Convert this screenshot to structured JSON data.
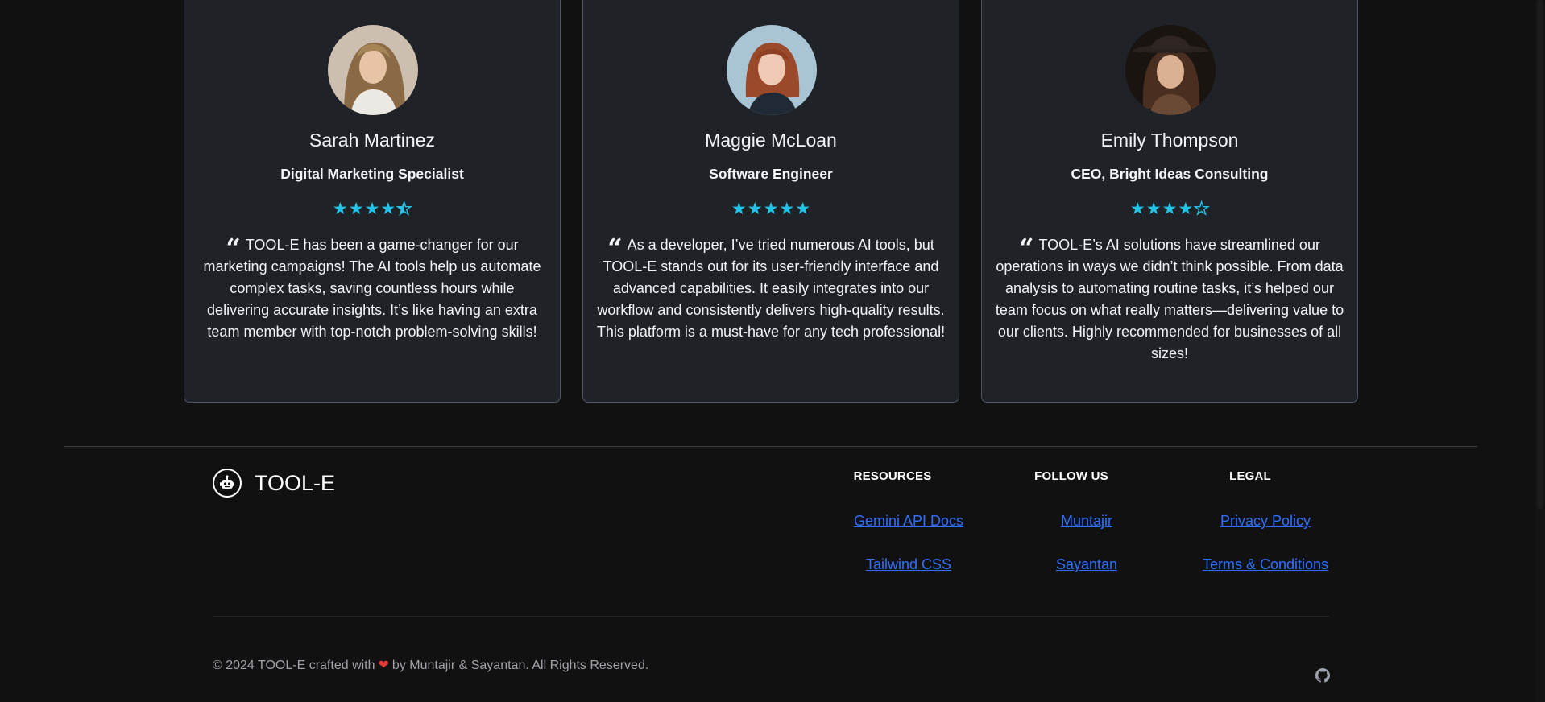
{
  "testimonials": [
    {
      "name": "Sarah Martinez",
      "role": "Digital Marketing Specialist",
      "rating": 4.5,
      "quote": "TOOL-E has been a game-changer for our marketing campaigns! The AI tools help us automate complex tasks, saving countless hours while delivering accurate insights. It’s like having an extra team member with top-notch problem-solving skills!"
    },
    {
      "name": "Maggie McLoan",
      "role": "Software Engineer",
      "rating": 5,
      "quote": "As a developer, I’ve tried numerous AI tools, but TOOL-E stands out for its user-friendly interface and advanced capabilities. It easily integrates into our workflow and consistently delivers high-quality results. This platform is a must-have for any tech professional!"
    },
    {
      "name": "Emily Thompson",
      "role": "CEO, Bright Ideas Consulting",
      "rating": 4,
      "quote": "TOOL-E’s AI solutions have streamlined our operations in ways we didn’t think possible. From data analysis to automating routine tasks, it’s helped our team focus on what really matters—delivering value to our clients. Highly recommended for businesses of all sizes!"
    }
  ],
  "footer": {
    "brand": "TOOL-E",
    "columns": [
      {
        "heading": "RESOURCES",
        "links": [
          "Gemini API Docs",
          "Tailwind CSS"
        ]
      },
      {
        "heading": "FOLLOW US",
        "links": [
          "Muntajir",
          "Sayantan"
        ]
      },
      {
        "heading": "LEGAL",
        "links": [
          "Privacy Policy",
          "Terms & Conditions"
        ]
      }
    ],
    "copyright_pre": "© 2024 TOOL-E crafted with",
    "copyright_post": "by Muntajir & Sayantan. All Rights Reserved."
  },
  "colors": {
    "background": "#111111",
    "card": "#1f2227",
    "star": "#22c3e6",
    "link": "#2f6fff",
    "heart": "#e53935"
  }
}
